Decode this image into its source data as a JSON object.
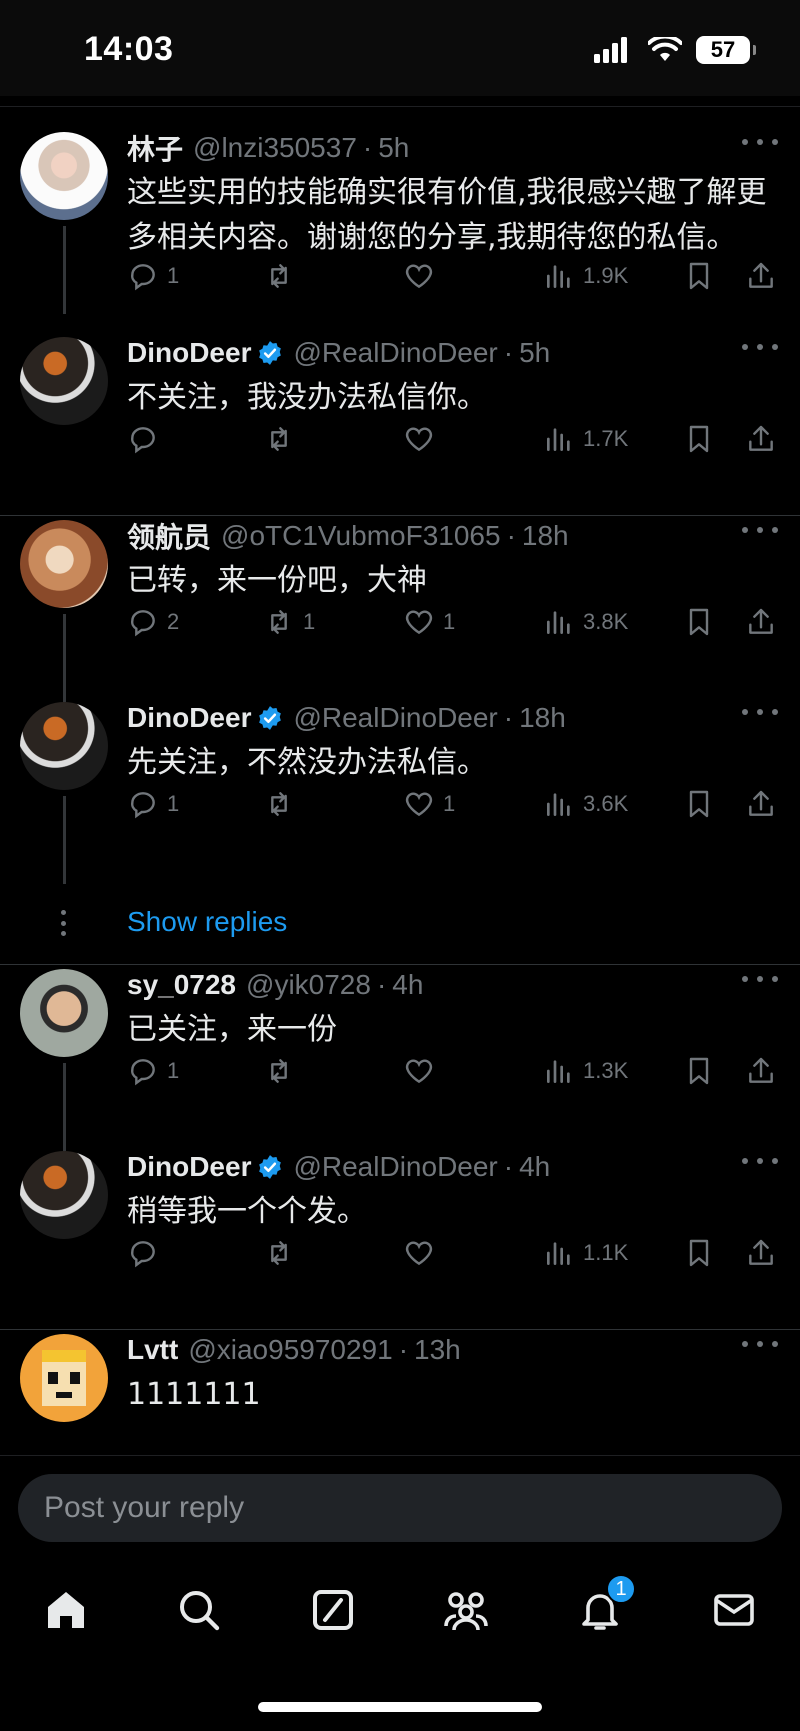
{
  "status": {
    "time": "14:03",
    "battery": "57"
  },
  "tweets": [
    {
      "name": "林子",
      "handle": "@lnzi350537",
      "time": "5h",
      "verified": false,
      "text": "这些实用的技能确实很有价值,我很感兴趣了解更多相关内容。谢谢您的分享,我期待您的私信。",
      "replies": "1",
      "retweets": "",
      "likes": "",
      "views": "1.9K"
    },
    {
      "name": "DinoDeer",
      "handle": "@RealDinoDeer",
      "time": "5h",
      "verified": true,
      "text": "不关注，我没办法私信你。",
      "replies": "",
      "retweets": "",
      "likes": "",
      "views": "1.7K"
    },
    {
      "name": "领航员",
      "handle": "@oTC1VubmoF31065",
      "time": "18h",
      "verified": false,
      "text": "已转，来一份吧，大神",
      "replies": "2",
      "retweets": "1",
      "likes": "1",
      "views": "3.8K"
    },
    {
      "name": "DinoDeer",
      "handle": "@RealDinoDeer",
      "time": "18h",
      "verified": true,
      "text": "先关注，不然没办法私信。",
      "replies": "1",
      "retweets": "",
      "likes": "1",
      "views": "3.6K"
    },
    {
      "name": "sy_0728",
      "handle": "@yik0728",
      "time": "4h",
      "verified": false,
      "text": "已关注，来一份",
      "replies": "1",
      "retweets": "",
      "likes": "",
      "views": "1.3K"
    },
    {
      "name": "DinoDeer",
      "handle": "@RealDinoDeer",
      "time": "4h",
      "verified": true,
      "text": "稍等我一个个发。",
      "replies": "",
      "retweets": "",
      "likes": "",
      "views": "1.1K"
    },
    {
      "name": "Lvtt",
      "handle": "@xiao95970291",
      "time": "13h",
      "verified": false,
      "text": "1111111",
      "replies": "",
      "retweets": "",
      "likes": "",
      "views": ""
    }
  ],
  "show_replies": "Show replies",
  "composer": {
    "placeholder": "Post your reply"
  },
  "tabbar": {
    "notifications_badge": "1"
  },
  "colors": {
    "background": "#000000",
    "accent": "#1d9bf0",
    "muted": "#71767b",
    "text": "#e7e9ea"
  },
  "icons": [
    "reply-icon",
    "retweet-icon",
    "like-icon",
    "views-icon",
    "bookmark-icon",
    "share-icon",
    "home-icon",
    "search-icon",
    "compose-icon",
    "communities-icon",
    "notifications-icon",
    "messages-icon"
  ]
}
